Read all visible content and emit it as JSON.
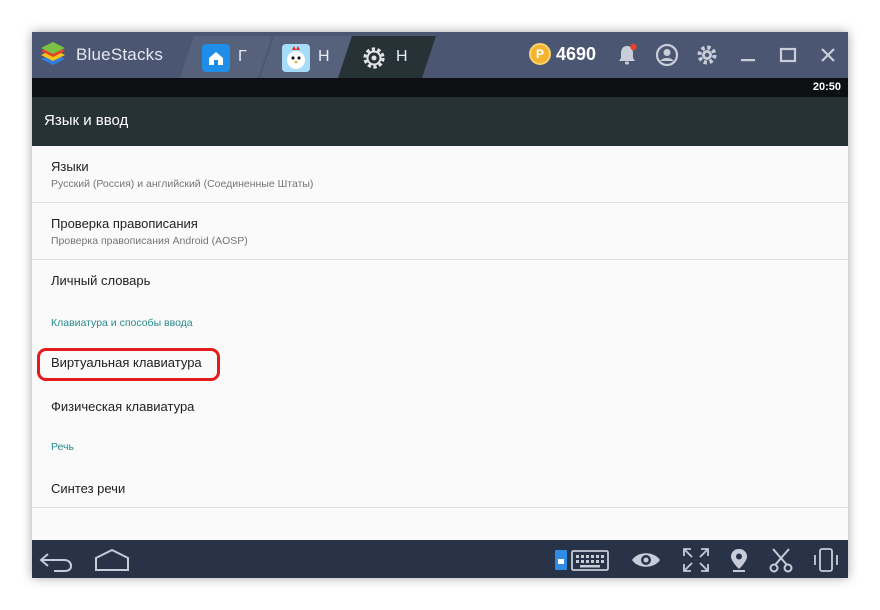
{
  "app": {
    "name": "BlueStacks",
    "coins": "4690",
    "coin_symbol": "P"
  },
  "tabs": [
    {
      "label": "Г",
      "icon": "home-icon"
    },
    {
      "label": "Н",
      "icon": "chicken-game-icon"
    },
    {
      "label": "Н",
      "icon": "settings-gear-icon"
    }
  ],
  "titlebar_icons": [
    "bell-icon",
    "account-icon",
    "gear-icon",
    "minimize-icon",
    "maximize-icon",
    "close-icon"
  ],
  "status": {
    "time": "20:50"
  },
  "page": {
    "title": "Язык и ввод"
  },
  "list": {
    "languages": {
      "title": "Языки",
      "summary": "Русский (Россия) и английский (Соединенные Штаты)"
    },
    "spellcheck": {
      "title": "Проверка правописания",
      "summary": "Проверка правописания Android (AOSP)"
    },
    "dictionary": {
      "title": "Личный словарь"
    },
    "section_keyboard": "Клавиатура и способы ввода",
    "virtual_keyboard": {
      "title": "Виртуальная клавиатура"
    },
    "physical_keyboard": {
      "title": "Физическая клавиатура"
    },
    "section_speech": "Речь",
    "tts": {
      "title": "Синтез речи"
    }
  },
  "bottom_icons": [
    "back-icon",
    "home-icon",
    "keyboard-icon",
    "eye-icon",
    "fullscreen-icon",
    "location-icon",
    "scissors-icon",
    "rotate-icon"
  ],
  "colors": {
    "titlebar": "#4b5672",
    "actionbar": "#273236",
    "section": "#268b8a",
    "highlight": "#e31b1b",
    "bottombar": "#283348"
  }
}
